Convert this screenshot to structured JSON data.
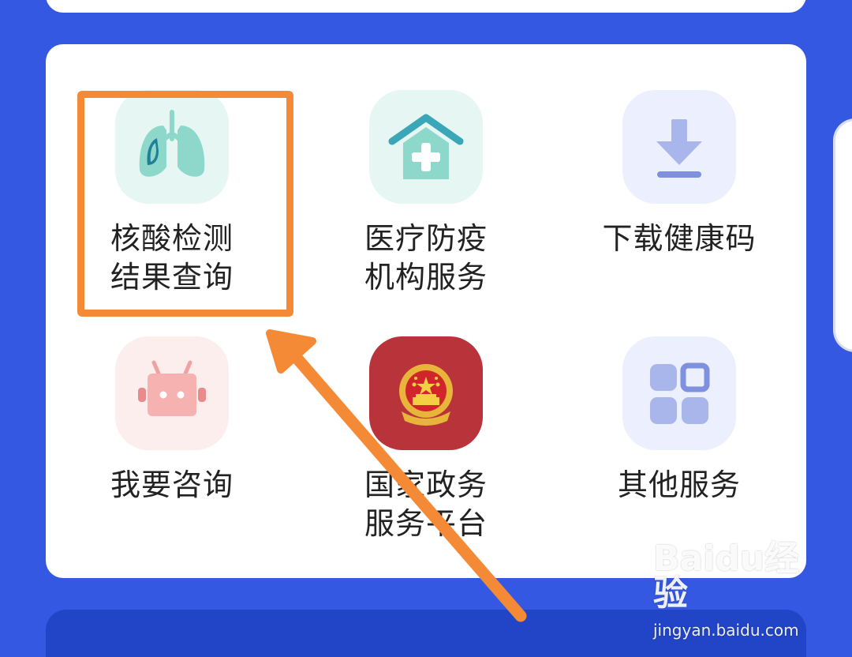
{
  "services": [
    {
      "id": "nucleic",
      "lines": [
        "核酸检测",
        "结果查询"
      ],
      "icon": "lungs-icon",
      "bg": "#e6f7f3"
    },
    {
      "id": "medical",
      "lines": [
        "医疗防疫",
        "机构服务"
      ],
      "icon": "clinic-icon",
      "bg": "#e6f7f3"
    },
    {
      "id": "download",
      "lines": [
        "下载健康码"
      ],
      "icon": "download-icon",
      "bg": "#eceffd"
    },
    {
      "id": "consult",
      "lines": [
        "我要咨询"
      ],
      "icon": "robot-icon",
      "bg": "#fdeeee"
    },
    {
      "id": "gov",
      "lines": [
        "国家政务",
        "服务平台"
      ],
      "icon": "national-emblem-icon",
      "bg": "#b8343a"
    },
    {
      "id": "other",
      "lines": [
        "其他服务"
      ],
      "icon": "grid-apps-icon",
      "bg": "#eceffd"
    }
  ],
  "watermark": {
    "brand": "Baidu经验",
    "url": "jingyan.baidu.com"
  },
  "colors": {
    "background": "#3558e3",
    "highlight": "#f58a36",
    "card": "#ffffff"
  }
}
